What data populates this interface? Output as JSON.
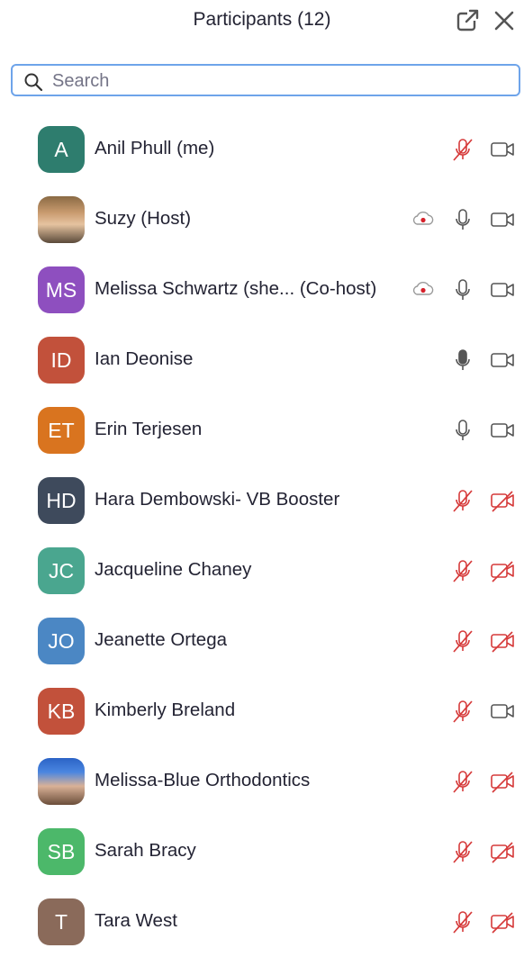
{
  "header": {
    "title": "Participants (12)"
  },
  "search": {
    "placeholder": "Search"
  },
  "participants": [
    {
      "name": "Anil Phull (me)",
      "initials": "A",
      "color": "#2e7d6e",
      "recording": false,
      "mic": "muted",
      "camera": "on"
    },
    {
      "name": "Suzy (Host)",
      "initials": "",
      "avatar": "photo",
      "recording": true,
      "mic": "on",
      "camera": "on"
    },
    {
      "name": "Melissa Schwartz (she...  (Co-host)",
      "initials": "MS",
      "color": "#8e4fbf",
      "recording": true,
      "mic": "on",
      "camera": "on"
    },
    {
      "name": "Ian Deonise",
      "initials": "ID",
      "color": "#c2513b",
      "recording": false,
      "mic": "active",
      "camera": "on"
    },
    {
      "name": "Erin Terjesen",
      "initials": "ET",
      "color": "#d9741f",
      "recording": false,
      "mic": "on",
      "camera": "on"
    },
    {
      "name": "Hara Dembowski- VB Booster",
      "initials": "HD",
      "color": "#3e4a5c",
      "recording": false,
      "mic": "muted",
      "camera": "off"
    },
    {
      "name": "Jacqueline Chaney",
      "initials": "JC",
      "color": "#4aa68f",
      "recording": false,
      "mic": "muted",
      "camera": "off"
    },
    {
      "name": "Jeanette Ortega",
      "initials": "JO",
      "color": "#4b87c4",
      "recording": false,
      "mic": "muted",
      "camera": "off"
    },
    {
      "name": "Kimberly Breland",
      "initials": "KB",
      "color": "#c2513b",
      "recording": false,
      "mic": "muted",
      "camera": "on"
    },
    {
      "name": "Melissa-Blue Orthodontics",
      "initials": "",
      "avatar": "photo",
      "recording": false,
      "mic": "muted",
      "camera": "off"
    },
    {
      "name": "Sarah Bracy",
      "initials": "SB",
      "color": "#4cb86a",
      "recording": false,
      "mic": "muted",
      "camera": "off"
    },
    {
      "name": "Tara West",
      "initials": "T",
      "color": "#8a6a5a",
      "recording": false,
      "mic": "muted",
      "camera": "off"
    }
  ]
}
